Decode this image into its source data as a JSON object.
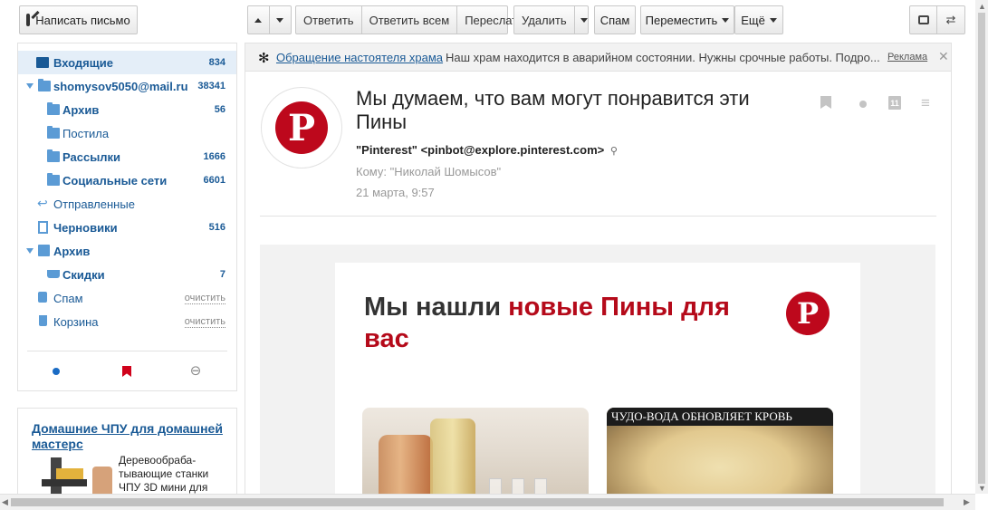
{
  "toolbar": {
    "compose": "Написать письмо",
    "reply": "Ответить",
    "reply_all": "Ответить всем",
    "forward": "Переслать",
    "delete": "Удалить",
    "spam": "Спам",
    "move": "Переместить",
    "more": "Ещё"
  },
  "folders": [
    {
      "label": "Входящие",
      "count": "834"
    },
    {
      "label": "shomysov5050@mail.ru",
      "count": "38341"
    },
    {
      "label": "Архив",
      "count": "56"
    },
    {
      "label": "Постила",
      "count": ""
    },
    {
      "label": "Рассылки",
      "count": "1666"
    },
    {
      "label": "Социальные сети",
      "count": "6601"
    },
    {
      "label": "Отправленные",
      "count": ""
    },
    {
      "label": "Черновики",
      "count": "516"
    },
    {
      "label": "Архив",
      "count": ""
    },
    {
      "label": "Скидки",
      "count": "7"
    },
    {
      "label": "Спам",
      "action": "очистить"
    },
    {
      "label": "Корзина",
      "action": "очистить"
    }
  ],
  "sidebar_ad": {
    "title": "Домашние ЧПУ для домашней мастерс",
    "text": "Деревообраба-тывающие станки ЧПУ 3D мини для"
  },
  "ad_line": {
    "link": "Обращение настоятеля храма",
    "text": "Наш храм находится в аварийном состоянии. Нужны срочные работы. Подро...",
    "label": "Реклама"
  },
  "message": {
    "subject": "Мы думаем, что вам могут понравится эти Пины",
    "sender": "\"Pinterest\" <pinbot@explore.pinterest.com>",
    "to": "Кому: \"Николай Шомысов\"",
    "date": "21 марта, 9:57",
    "calendar_day": "11"
  },
  "body": {
    "headline_start": "Мы нашли ",
    "headline_red": "новые Пины для вас",
    "pin2_caption": "ЧУДО-ВОДА ОБНОВЛЯЕТ КРОВЬ"
  },
  "colors": {
    "pinterest_red": "#bd081c",
    "link_blue": "#1a5a96",
    "active_folder_bg": "#e4eef8"
  }
}
